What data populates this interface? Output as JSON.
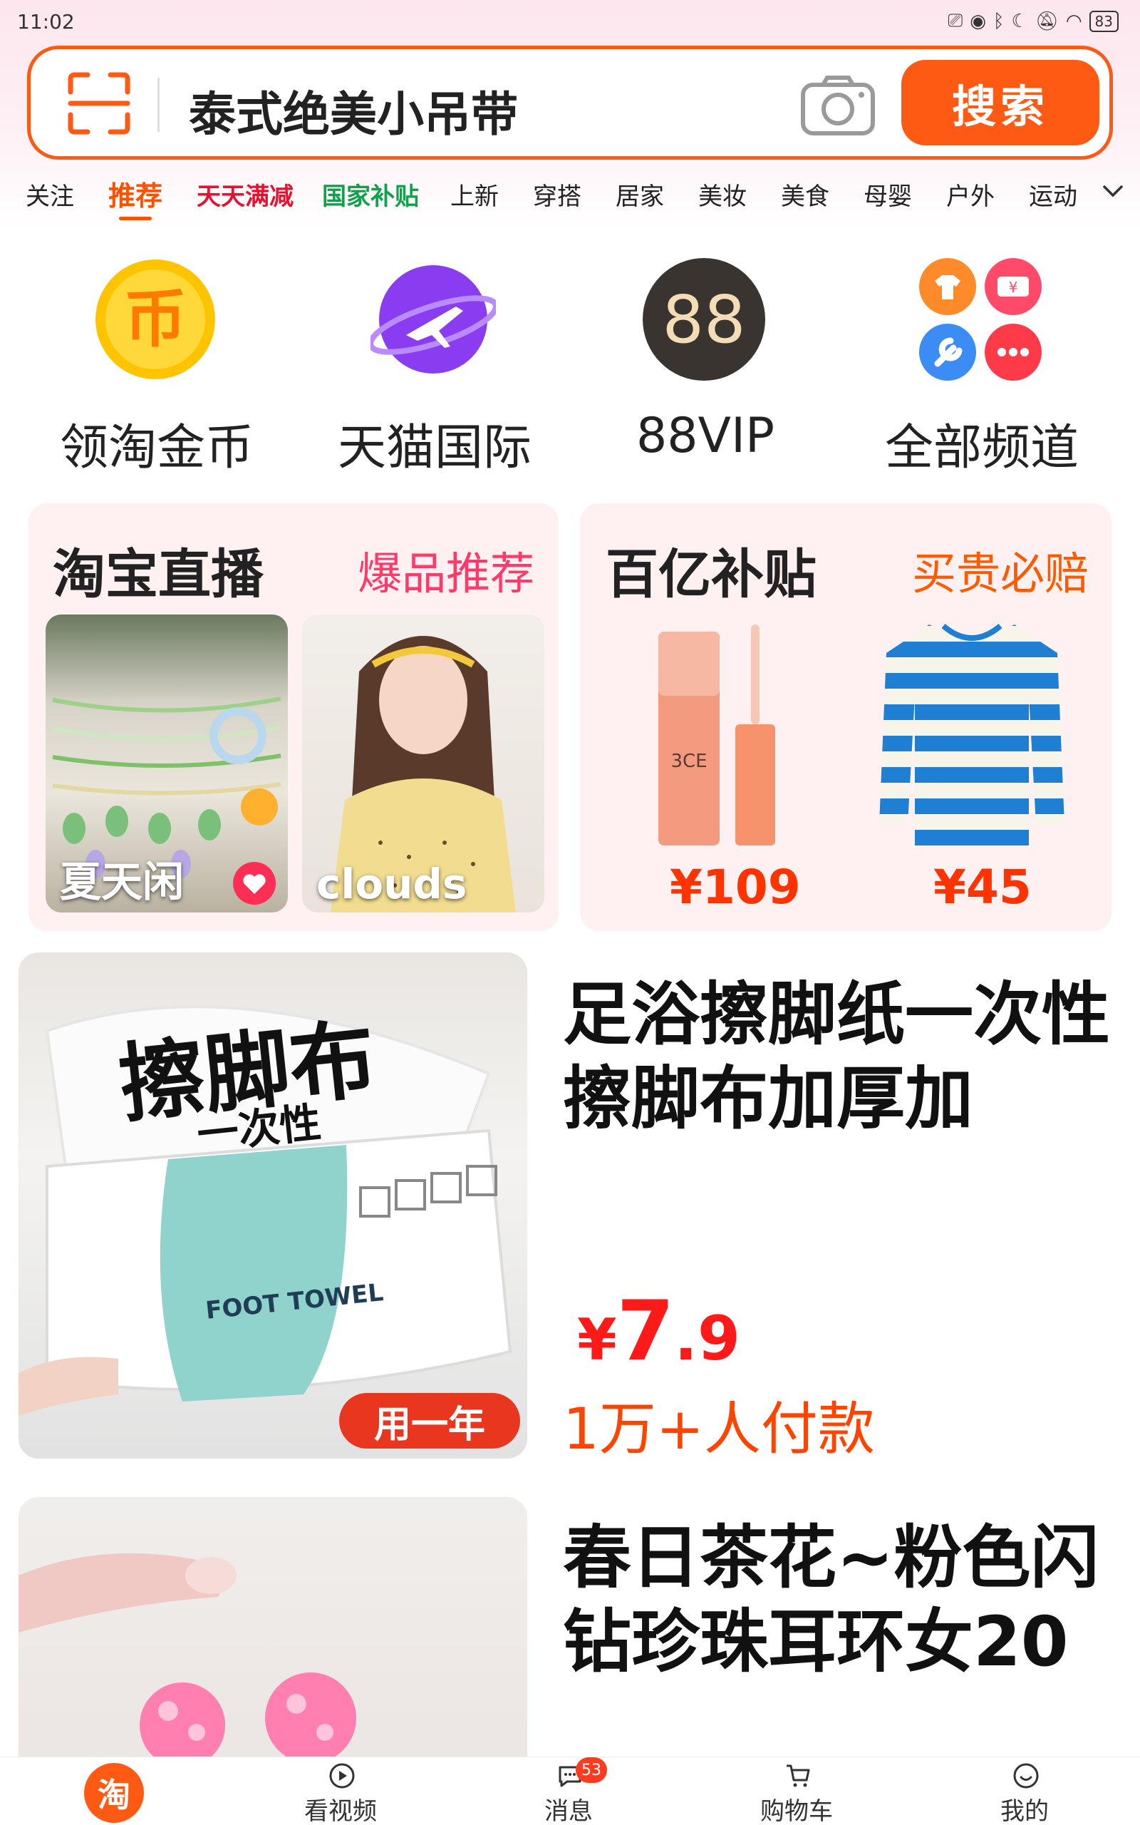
{
  "status_bar": {
    "time": "11:02",
    "battery": "83"
  },
  "search": {
    "query": "泰式绝美小吊带",
    "button_label": "搜索"
  },
  "tabs": [
    {
      "label": "关注"
    },
    {
      "label": "推荐"
    },
    {
      "label": "天天满减"
    },
    {
      "label": "国家补贴"
    },
    {
      "label": "上新"
    },
    {
      "label": "穿搭"
    },
    {
      "label": "居家"
    },
    {
      "label": "美妆"
    },
    {
      "label": "美食"
    },
    {
      "label": "母婴"
    },
    {
      "label": "户外"
    },
    {
      "label": "运动"
    }
  ],
  "active_tab": "推荐",
  "channels": [
    {
      "label": "领淘金币",
      "icon": "gold-coin-icon"
    },
    {
      "label": "天猫国际",
      "icon": "tmall-global-icon"
    },
    {
      "label": "88VIP",
      "icon": "88vip-icon",
      "icon_text": "88"
    },
    {
      "label": "全部频道",
      "icon": "all-channels-icon"
    }
  ],
  "live_card": {
    "title": "淘宝直播",
    "subtitle": "爆品推荐",
    "items": [
      {
        "caption": "夏天闲"
      },
      {
        "caption": "clouds"
      }
    ]
  },
  "subsidy_card": {
    "title": "百亿补贴",
    "subtitle": "买贵必赔",
    "items": [
      {
        "price": "¥109"
      },
      {
        "price": "¥45"
      }
    ]
  },
  "products": [
    {
      "image_text_main": "擦脚布",
      "image_text_sub": "一次性",
      "image_brand": "FOOT TOWEL",
      "image_tag": "用一年",
      "title": "足浴擦脚纸一次性擦脚布加厚加",
      "price_currency": "¥",
      "price_int": "7",
      "price_dec": ".9",
      "sales": "1万+人付款"
    },
    {
      "title": "春日茶花~粉色闪钻珍珠耳环女20"
    }
  ],
  "bottom_nav": [
    {
      "label": "淘"
    },
    {
      "label": "看视频"
    },
    {
      "label": "消息",
      "badge": "53"
    },
    {
      "label": "购物车"
    },
    {
      "label": "我的"
    }
  ],
  "colors": {
    "brand": "#ff5a14",
    "price": "#ff1a1a",
    "tab_red": "#e8102e",
    "tab_green": "#12a14b"
  }
}
